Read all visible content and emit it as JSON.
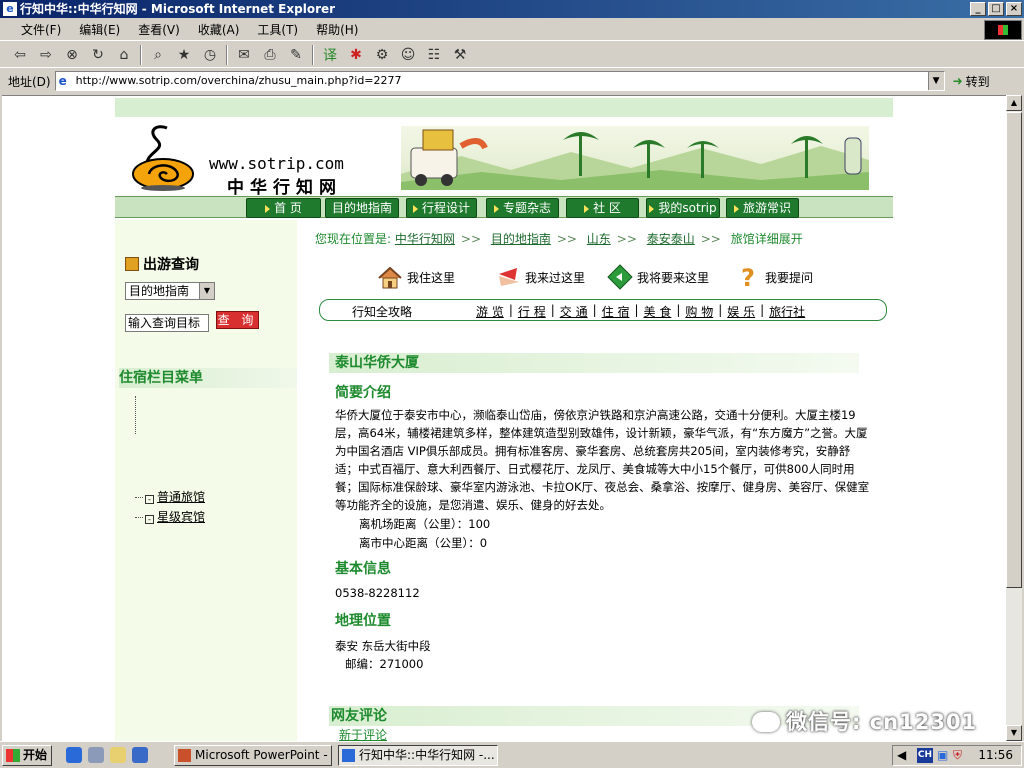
{
  "window": {
    "title": "行知中华::中华行知网 - Microsoft Internet Explorer"
  },
  "menu": [
    "文件(F)",
    "编辑(E)",
    "查看(V)",
    "收藏(A)",
    "工具(T)",
    "帮助(H)"
  ],
  "address": {
    "label": "地址(D)",
    "url": "http://www.sotrip.com/overchina/zhusu_main.php?id=2277",
    "go": "转到"
  },
  "site": {
    "url": "www.sotrip.com",
    "name": "中华行知网"
  },
  "nav": [
    "首 页",
    "目的地指南",
    "行程设计",
    "专题杂志",
    "社 区",
    "我的sotrip",
    "旅游常识"
  ],
  "left": {
    "search_title": "出游查询",
    "select_value": "目的地指南",
    "search_input_value": "输入查询目标",
    "search_button": "查 询",
    "lodge_menu_title": "住宿栏目菜单",
    "lodge_items": [
      "普通旅馆",
      "星级宾馆"
    ]
  },
  "breadcrumb": {
    "prefix": "您现在位置是:",
    "items": [
      "中华行知网",
      "目的地指南",
      "山东",
      "泰安泰山"
    ],
    "current": "旅馆详细展开"
  },
  "actions": [
    "我住这里",
    "我来过这里",
    "我将要来这里",
    "我要提问"
  ],
  "subnav": {
    "label": "行知全攻略",
    "items": [
      "游 览",
      "行 程",
      "交 通",
      "住 宿",
      "美 食",
      "购 物",
      "娱 乐",
      "旅行社"
    ]
  },
  "hotel": {
    "name": "泰山华侨大厦",
    "intro_title": "简要介绍",
    "intro": "华侨大厦位于泰安市中心，濒临泰山岱庙，傍依京沪铁路和京沪高速公路，交通十分便利。大厦主楼19层，高64米，辅楼裙建筑多样，整体建筑造型别致雄伟，设计新颖，豪华气派，有“东方魔方”之誉。大厦为中国名酒店 VIP俱乐部成员。拥有标准客房、豪华套房、总统套房共205间，室内装修考究，安静舒适；中式百福厅、意大利西餐厅、日式樱花厅、龙凤厅、美食城等大中小15个餐厅，可供800人同时用餐；国际标准保龄球、豪华室内游泳池、卡拉OK厅、夜总会、桑拿浴、按摩厅、健身房、美容厅、保健室等功能齐全的设施，是您消遣、娱乐、健身的好去处。",
    "airport": "离机场距离（公里）：100",
    "center": "离市中心距离（公里）：0",
    "basic_title": "基本信息",
    "phone": "0538-8228112",
    "location_title": "地理位置",
    "address": "泰安 东岳大街中段",
    "postcode": "邮编：271000",
    "review_title": "网友评论",
    "review_sub": "新于评论"
  },
  "watermark": "微信号: cn12301",
  "taskbar": {
    "start": "开始",
    "tasks": [
      "Microsoft PowerPoint - [...",
      "行知中华::中华行知网 -..."
    ],
    "lang": "CH",
    "clock": "11:56"
  },
  "colors": {
    "accent_green": "#1e8a2e",
    "nav_green": "#1f7a2e",
    "title_blue": "#0a246a",
    "search_red": "#d83030"
  }
}
